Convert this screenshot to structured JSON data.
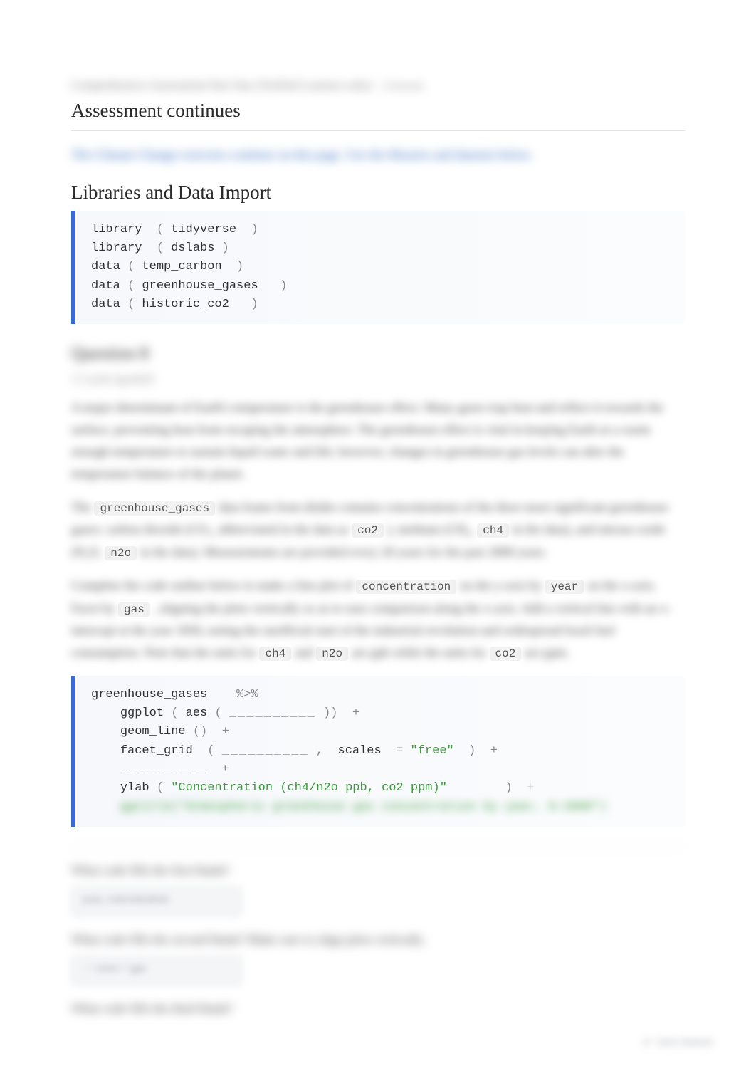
{
  "meta": {
    "line1": "Comprehensive Assessment Part One (Verified Learners only)",
    "tag": "| External"
  },
  "section": {
    "title": "Assessment continues",
    "intro_blur": "The Climate Change exercises continue on this page. Use the libraries and datasets below.",
    "libs_heading": "Libraries and Data Import"
  },
  "code1": {
    "l1_fn": "library",
    "l1_arg": "tidyverse",
    "l2_fn": "library",
    "l2_arg": "dslabs",
    "l3_fn": "data",
    "l3_arg": "temp_carbon",
    "l4_fn": "data",
    "l4_arg": "greenhouse_gases",
    "l5_fn": "data",
    "l5_arg": "historic_co2"
  },
  "q_heading": "Question 8",
  "subheading_blur": "1/1 point (graded)",
  "para1": {
    "blur_a": "A major determinant of Earth's temperature is the greenhouse effect. Many gases trap heat and reflect it towards the surface, preventing heat from escaping the atmosphere. The greenhouse effect is vital in keeping Earth at a warm enough temperature to sustain liquid water and life; however, changes in greenhouse gas levels can alter the temperature balance of the planet."
  },
  "para2": {
    "blur_a": "The",
    "chip1": "greenhouse_gases",
    "blur_b": "data frame from dslabs contains concentrations of the three most significant greenhouse gases: carbon dioxide (CO₂, abbreviated in the data as",
    "chip_co2": "co2",
    "blur_c": "), methane (CH₄,",
    "chip_ch4": "ch4",
    "blur_d": "in the data), and nitrous oxide (N₂O,",
    "chip_n2o": "n2o",
    "blur_e": "in the data). Measurements are provided every 20 years for the past 2000 years."
  },
  "para3": {
    "blur_a": "Complete the code outline below to make a line plot of",
    "chip_conc": "concentration",
    "blur_b": "on the y-axis by",
    "chip_year": "year",
    "blur_c": "on the x-axis. Facet by",
    "chip_gas": "gas",
    "blur_d": ", aligning the plots vertically so as to ease comparison along the x-axis. Add a vertical line with an x-intercept at the year 1850, noting the unofficial start of the industrial revolution and widespread fossil fuel consumption. Note that the units for",
    "chip_ch4": "ch4",
    "blur_e": "and",
    "chip_n2o": "n2o",
    "blur_f": "are ppb while the units for",
    "chip_co2": "co2",
    "blur_g": "are ppm."
  },
  "code2": {
    "l1_id": "greenhouse_gases",
    "l1_op": "%>%",
    "l2_fn": "ggplot",
    "l2_in": "aes",
    "l2_blank": "__________",
    "l3_fn": "geom_line",
    "l4_fn": "facet_grid",
    "l4_blank": "__________",
    "l4_lbl": "scales",
    "l4_val": "\"free\"",
    "l5_blank": "__________",
    "l6_fn": "ylab",
    "l6_val": "\"Concentration (ch4/n2o ppb, co2 ppm)\"",
    "l7_faint": "ggtitle(\"Atmospheric greenhouse gas concentration by year, 0-2000\")"
  },
  "prompts": {
    "p1": "What code fills the first blank?",
    "p1_input": "year, concentration",
    "p2": "What code fills the second blank? Make sure to align plots vertically.",
    "p2_input": ". ~ rows = gas",
    "p3": "What code fills the third blank?"
  },
  "save_note": "✔  Save Answer"
}
